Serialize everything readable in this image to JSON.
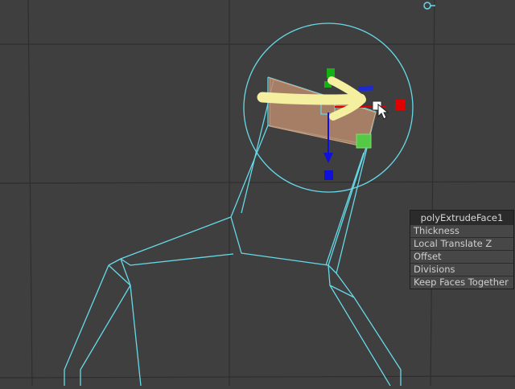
{
  "viewport": {
    "name": "perspective-viewport",
    "background": "#3f3f3f",
    "grid_color": "#2e2e2e",
    "wire_color": "#66d9e8",
    "manip_colors": {
      "x": "#e00000",
      "y": "#14b014",
      "z": "#1010dd"
    }
  },
  "hud": {
    "title": "polyExtrudeFace1",
    "attributes": [
      "Thickness",
      "Local Translate Z",
      "Offset",
      "Divisions",
      "Keep Faces Together"
    ]
  },
  "annotation": {
    "shape": "arrow-right",
    "color": "#f5f0a0"
  }
}
